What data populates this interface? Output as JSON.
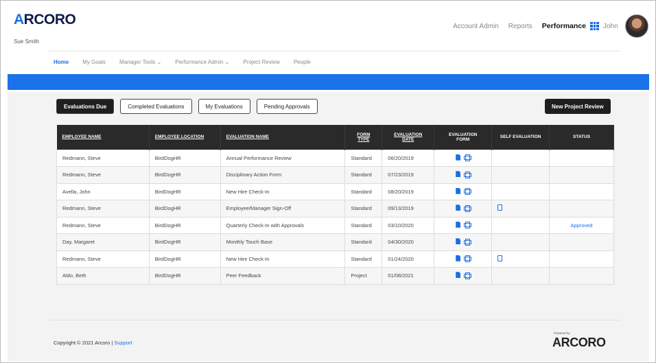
{
  "brand": {
    "logo_a": "A",
    "logo_rest": "RCORO"
  },
  "user": {
    "name": "Sue Smith",
    "short": "John"
  },
  "topnav": {
    "account_admin": "Account Admin",
    "reports": "Reports",
    "performance": "Performance"
  },
  "mainnav": [
    "Home",
    "My Goals",
    "Manager Tools ⌄",
    "Performance Admin ⌄",
    "Project Review",
    "People"
  ],
  "tabs": {
    "evaluations_due": "Evaluations Due",
    "completed": "Completed Evaluations",
    "my_evaluations": "My Evaluations",
    "pending": "Pending Approvals",
    "new_project_review": "New Project Review"
  },
  "table": {
    "headers": {
      "employee_name": "EMPLOYEE NAME",
      "employee_location": "EMPLOYEE LOCATION",
      "evaluation_name": "EVALUATION NAME",
      "form_type_1": "FORM",
      "form_type_2": "TYPE",
      "evaluation_date_1": "EVALUATION",
      "evaluation_date_2": "DATE",
      "evaluation_form_1": "EVALUATION",
      "evaluation_form_2": "FORM",
      "self_evaluation": "SELF EVALUATION",
      "status": "STATUS"
    },
    "rows": [
      {
        "name": "Redmann, Steve",
        "location": "BirdDogHR",
        "evaluation": "Annual Performance Review",
        "type": "Standard",
        "date": "06/20/2019",
        "self": false,
        "status": ""
      },
      {
        "name": "Redmann, Steve",
        "location": "BirdDogHR",
        "evaluation": "Disciplinary Action Form",
        "type": "Standard",
        "date": "07/23/2019",
        "self": false,
        "status": ""
      },
      {
        "name": "Avella, John",
        "location": "BirdDogHR",
        "evaluation": "New Hire Check-In",
        "type": "Standard",
        "date": "08/20/2019",
        "self": false,
        "status": ""
      },
      {
        "name": "Redmann, Steve",
        "location": "BirdDogHR",
        "evaluation": "Employee/Manager Sign-Off",
        "type": "Standard",
        "date": "09/13/2019",
        "self": true,
        "status": ""
      },
      {
        "name": "Redmann, Steve",
        "location": "BirdDogHR",
        "evaluation": "Quarterly Check-In with Approvals",
        "type": "Standard",
        "date": "03/10/2020",
        "self": false,
        "status": "Approved"
      },
      {
        "name": "Day, Margaret",
        "location": "BirdDogHR",
        "evaluation": "Monthly Touch Base",
        "type": "Standard",
        "date": "04/30/2020",
        "self": false,
        "status": ""
      },
      {
        "name": "Redmann, Steve",
        "location": "BirdDogHR",
        "evaluation": "New Hire Check-In",
        "type": "Standard",
        "date": "01/24/2020",
        "self": true,
        "status": ""
      },
      {
        "name": "Aldo, Beth",
        "location": "BirdDogHR",
        "evaluation": "Peer Feedback",
        "type": "Project",
        "date": "01/08/2021",
        "self": false,
        "status": ""
      }
    ]
  },
  "footer": {
    "copyright": "Copyright © 2021 Arcoro | ",
    "support": "Support",
    "powered_by": "Powered by",
    "logo_a": "A",
    "logo_rest": "RCORO"
  },
  "colors": {
    "accent": "#1a73e8",
    "dark": "#1f1f1f",
    "brand_navy": "#0d1b4a"
  }
}
